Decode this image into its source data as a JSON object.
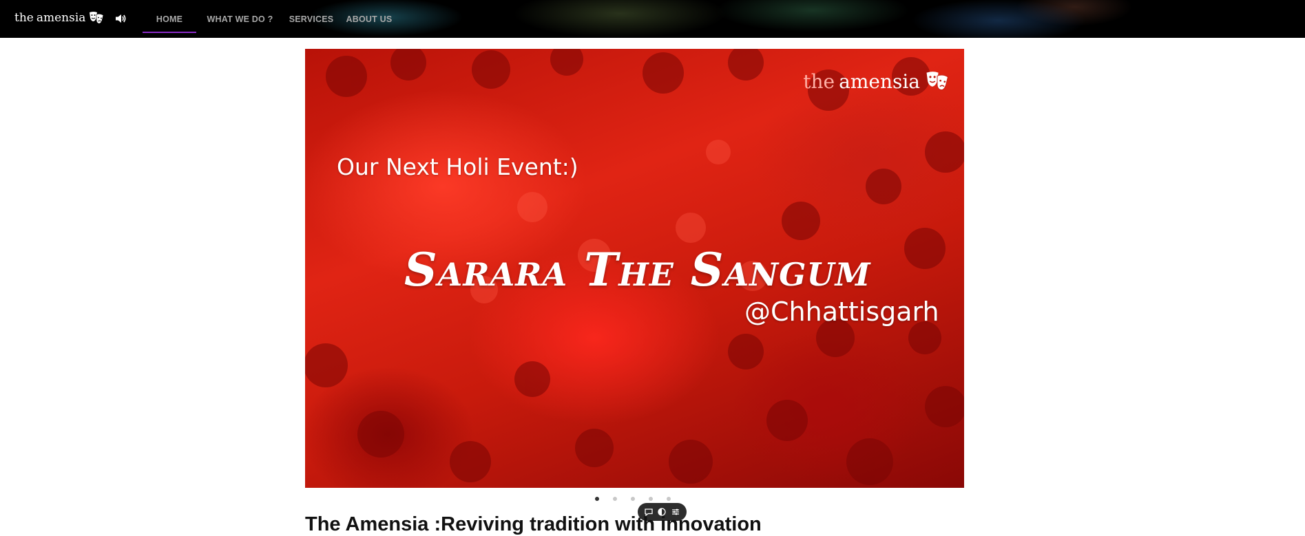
{
  "brand": {
    "the": "the",
    "name": "amensia",
    "icon": "theater-masks-icon"
  },
  "header": {
    "sound_icon": "speaker-icon"
  },
  "nav": {
    "items": [
      {
        "label": "HOME",
        "active": true
      },
      {
        "label": "WHAT WE DO ?",
        "active": false
      },
      {
        "label": "SERVICES",
        "active": false
      },
      {
        "label": "ABOUT US",
        "active": false
      }
    ]
  },
  "hero": {
    "logo_the": "the",
    "logo_name": "amensia",
    "kicker": "Our Next Holi Event:)",
    "title": "Sarara The Sangum",
    "place": "@Chhattisgarh"
  },
  "carousel": {
    "slide_count": 5,
    "active_index": 0
  },
  "toolbar": {
    "icons": [
      "chat-bubble-icon",
      "contrast-icon",
      "settings-sliders-icon"
    ]
  },
  "section": {
    "title": "The Amensia :Reviving tradition with innovation"
  },
  "colors": {
    "topbar_bg": "#000000",
    "nav_text": "#a8a8a8",
    "nav_active_underline": "#8a2bc8",
    "hero_red": "#e02414"
  }
}
